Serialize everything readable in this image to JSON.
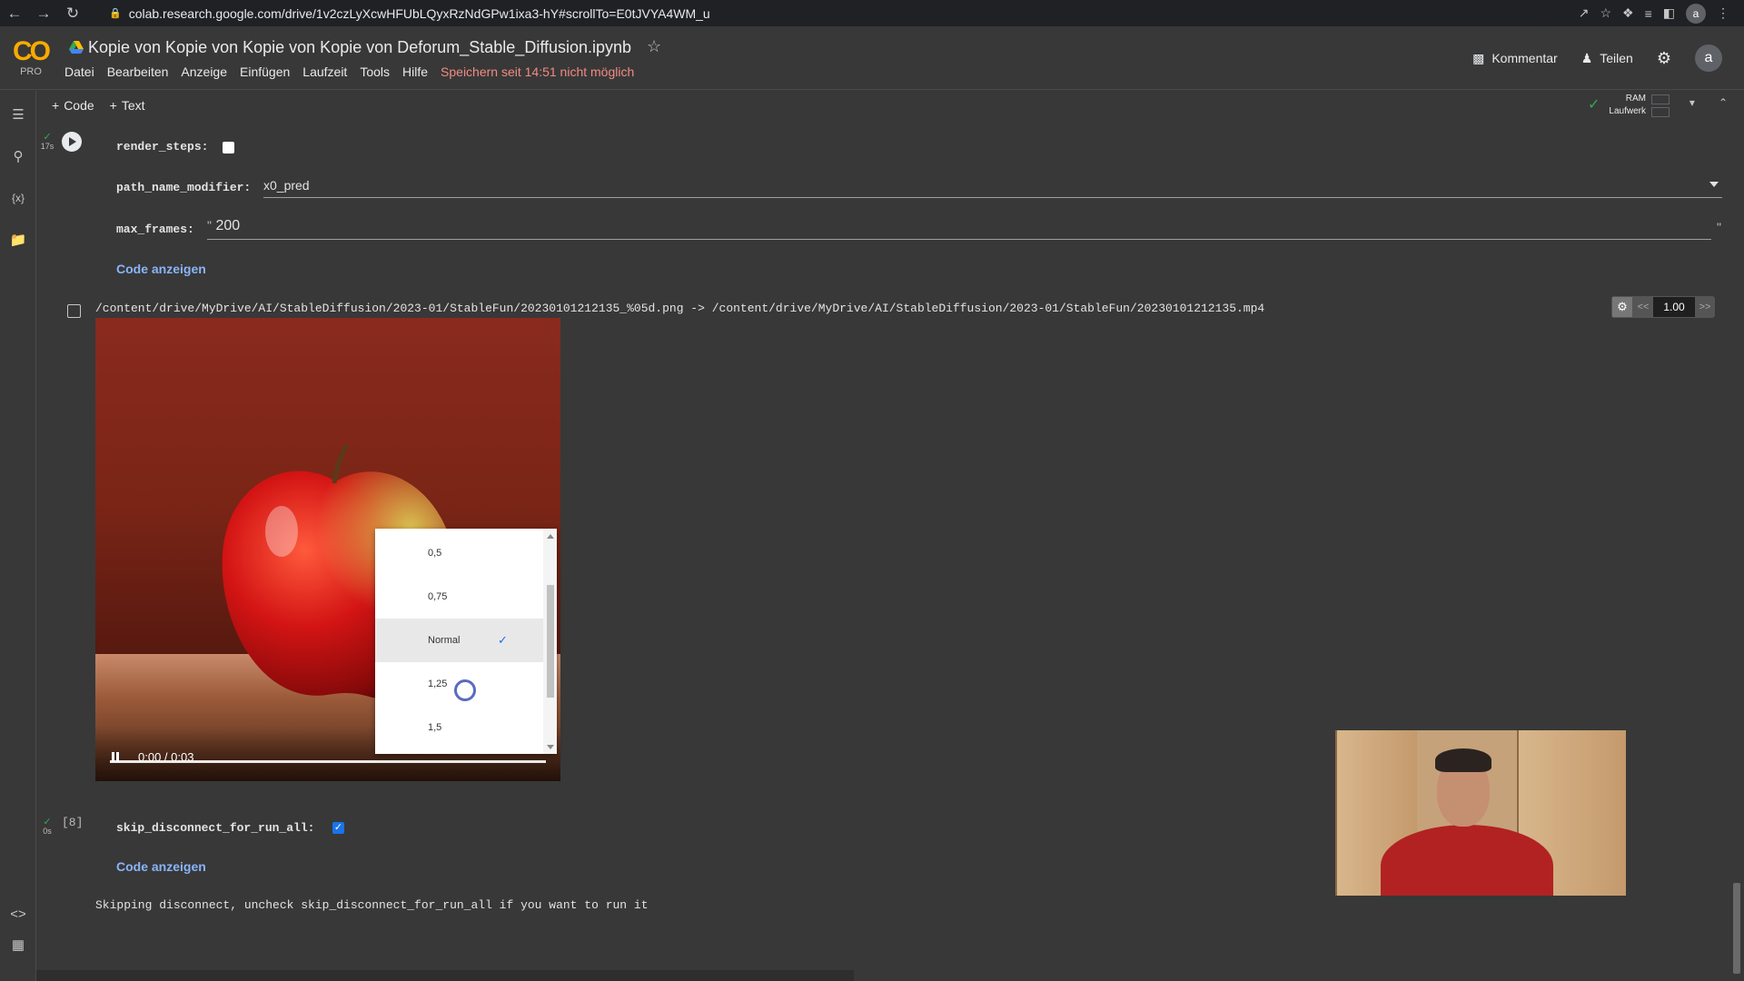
{
  "browser": {
    "url": "colab.research.google.com/drive/1v2czLyXcwHFUbLQyxRzNdGPw1ixa3-hY#scrollTo=E0tJVYA4WM_u",
    "avatar": "a"
  },
  "header": {
    "logo_text": "CO",
    "logo_sub": "PRO",
    "title": "Kopie von Kopie von Kopie von Kopie von Deforum_Stable_Diffusion.ipynb",
    "menu": [
      "Datei",
      "Bearbeiten",
      "Anzeige",
      "Einfügen",
      "Laufzeit",
      "Tools",
      "Hilfe"
    ],
    "save_warning": "Speichern seit 14:51 nicht möglich",
    "comment_label": "Kommentar",
    "share_label": "Teilen",
    "user_avatar": "a"
  },
  "toolbar": {
    "code_label": "Code",
    "text_label": "Text",
    "ram_label": "RAM",
    "disk_label": "Laufwerk"
  },
  "cell1": {
    "exec_time": "17s",
    "render_steps_label": "render_steps:",
    "render_steps_checked": false,
    "path_name_modifier_label": "path_name_modifier:",
    "path_name_modifier_value": "x0_pred",
    "max_frames_label": "max_frames:",
    "max_frames_value": "200",
    "show_code_label": "Code anzeigen",
    "output_path": "/content/drive/MyDrive/AI/StableDiffusion/2023-01/StableFun/20230101212135_%05d.png -> /content/drive/MyDrive/AI/StableDiffusion/2023-01/StableFun/20230101212135.mp4",
    "speed_value": "1.00",
    "speed_prev": "<<",
    "speed_next": ">>"
  },
  "video": {
    "time": "0:00 / 0:03",
    "playback_speeds": [
      "0,5",
      "0,75",
      "Normal",
      "1,25",
      "1,5"
    ],
    "selected_speed": "Normal"
  },
  "cell2": {
    "exec_time": "0s",
    "cell_number": "[8]",
    "skip_label": "skip_disconnect_for_run_all:",
    "skip_checked": true,
    "show_code_label": "Code anzeigen",
    "output": "Skipping disconnect, uncheck skip_disconnect_for_run_all if you want to run it"
  },
  "colors": {
    "background": "#383838",
    "accent": "#f9ab00",
    "link": "#8ab4f8",
    "warning": "#f28b82",
    "success": "#34a853"
  }
}
